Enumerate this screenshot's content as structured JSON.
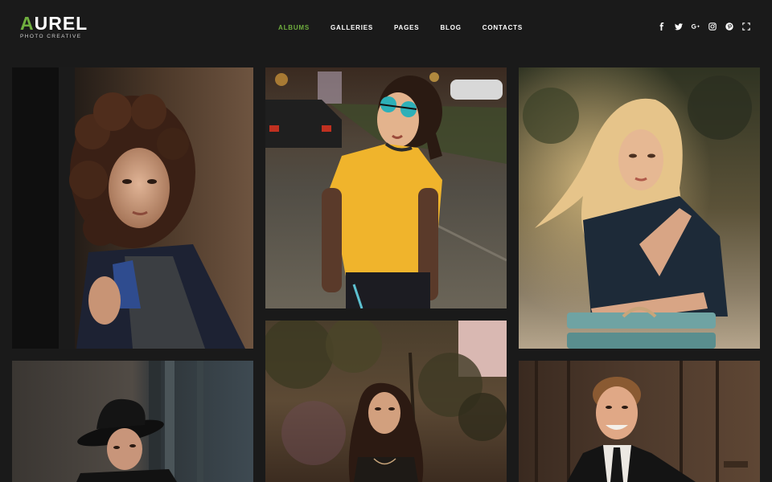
{
  "logo": {
    "first_letter": "A",
    "rest": "UREL",
    "tagline": "PHOTO CREATIVE"
  },
  "nav": [
    {
      "label": "ALBUMS",
      "active": true
    },
    {
      "label": "GALLERIES",
      "active": false
    },
    {
      "label": "PAGES",
      "active": false
    },
    {
      "label": "BLOG",
      "active": false
    },
    {
      "label": "CONTACTS",
      "active": false
    }
  ],
  "social_icons": [
    "facebook-icon",
    "twitter-icon",
    "google-plus-icon",
    "instagram-icon",
    "pinterest-icon",
    "fullscreen-icon"
  ],
  "colors": {
    "accent": "#6fae3e",
    "background": "#1a1a1a",
    "text": "#ffffff"
  },
  "gallery": [
    {
      "subject": "curly-haired woman by doorway"
    },
    {
      "subject": "woman in yellow t-shirt with sunglasses on street at night"
    },
    {
      "subject": "blonde woman leaning on bench"
    },
    {
      "subject": "woman in black hat by wooden door"
    },
    {
      "subject": "curly-haired woman in forest"
    },
    {
      "subject": "smiling man in suit and tie"
    }
  ]
}
